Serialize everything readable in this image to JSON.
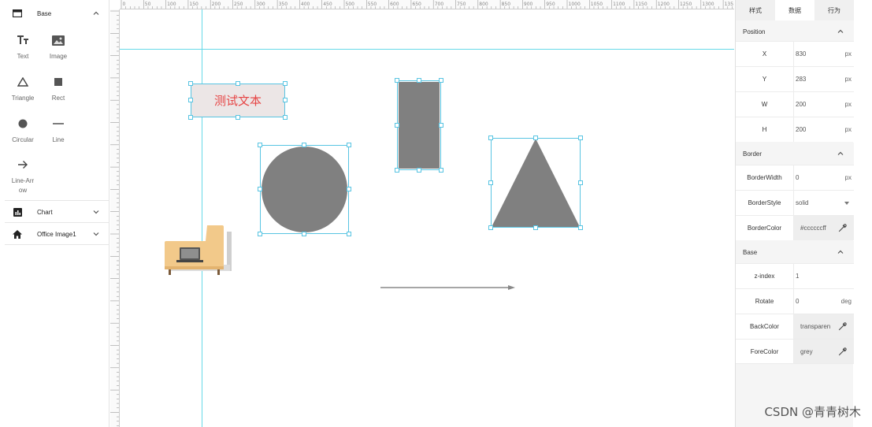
{
  "left_panel": {
    "groups": [
      {
        "label": "Base",
        "icon": "panel-icon",
        "expanded": true
      },
      {
        "label": "Chart",
        "icon": "bar-chart-icon",
        "expanded": false
      },
      {
        "label": "Office Image1",
        "icon": "home-icon",
        "expanded": false
      }
    ],
    "tools": [
      {
        "label": "Text",
        "icon": "text-tool-icon"
      },
      {
        "label": "Image",
        "icon": "image-tool-icon"
      },
      {
        "label": "Triangle",
        "icon": "triangle-tool-icon"
      },
      {
        "label": "Rect",
        "icon": "rect-tool-icon"
      },
      {
        "label": "Circular",
        "icon": "circle-tool-icon"
      },
      {
        "label": "Line",
        "icon": "line-tool-icon"
      },
      {
        "label": "Line-Arrow",
        "icon": "arrow-tool-icon"
      }
    ]
  },
  "canvas": {
    "ruler_top_labels": [
      "0",
      "50",
      "100",
      "150",
      "200",
      "250",
      "300",
      "350",
      "400",
      "450",
      "500",
      "550",
      "600",
      "650",
      "700",
      "750",
      "800",
      "850",
      "900",
      "950",
      "1000",
      "1050",
      "1100",
      "1150",
      "1200",
      "1250",
      "1300",
      "135"
    ],
    "text_element": "测试文本",
    "colors": {
      "guide": "#66d9e8",
      "selection": "#58c4e2",
      "shape_fill": "#808080",
      "text_color": "#e64545",
      "text_bg": "#ece6e6"
    }
  },
  "right_panel": {
    "tabs": [
      "样式",
      "数据",
      "行为"
    ],
    "active_tab": "数据",
    "sections": {
      "position": {
        "title": "Position",
        "rows": [
          {
            "label": "X",
            "value": "830",
            "unit": "px"
          },
          {
            "label": "Y",
            "value": "283",
            "unit": "px"
          },
          {
            "label": "W",
            "value": "200",
            "unit": "px"
          },
          {
            "label": "H",
            "value": "200",
            "unit": "px"
          }
        ]
      },
      "border": {
        "title": "Border",
        "rows": [
          {
            "label": "BorderWidth",
            "value": "0",
            "unit": "px"
          },
          {
            "label": "BorderStyle",
            "value": "solid"
          },
          {
            "label": "BorderColor",
            "value": "#ccccccff"
          }
        ]
      },
      "base": {
        "title": "Base",
        "rows": [
          {
            "label": "z-index",
            "value": "1"
          },
          {
            "label": "Rotate",
            "value": "0",
            "unit": "deg"
          },
          {
            "label": "BackColor",
            "value": "transparent"
          },
          {
            "label": "ForeColor",
            "value": "grey"
          }
        ]
      }
    }
  },
  "watermark": "CSDN @青青树木"
}
